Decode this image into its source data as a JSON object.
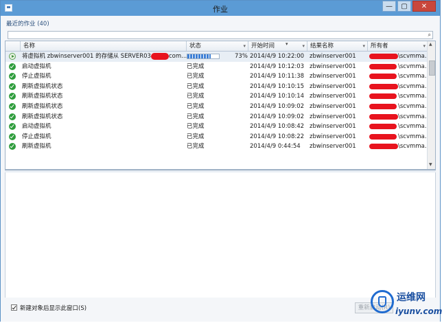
{
  "window": {
    "title": "作业",
    "controls": [
      "—",
      "▢",
      "✕"
    ]
  },
  "recent_label": "最近的作业 (40)",
  "search": {
    "placeholder": "",
    "value": ""
  },
  "icons": {
    "search": "search-icon",
    "succeeded": "checkmark-circle-icon",
    "running": "play-circle-icon",
    "app": "jobs-window-icon"
  },
  "columns": [
    {
      "label": "名称",
      "dropdown": false
    },
    {
      "label": "状态",
      "dropdown": true
    },
    {
      "label": "开始时间",
      "dropdown": true,
      "sorted": true
    },
    {
      "label": "结果名称",
      "dropdown": true
    },
    {
      "label": "所有者",
      "dropdown": true
    }
  ],
  "jobs": [
    {
      "name": "将虚拟机 zbwinserver001 的存储从 SERVER03",
      "name_tail": "com...",
      "status": "",
      "progress_percent": 73,
      "progress_label": "73%",
      "start_time": "2014/4/9 10:22:00",
      "result": "zbwinserver001",
      "owner_suffix": "\\scvmma...",
      "running": true
    },
    {
      "name": "启动虚拟机",
      "status": "已完成",
      "start_time": "2014/4/9 10:12:03",
      "result": "zbwinserver001",
      "owner_suffix": "\\scvmma...",
      "running": false
    },
    {
      "name": "停止虚拟机",
      "status": "已完成",
      "start_time": "2014/4/9 10:11:38",
      "result": "zbwinserver001",
      "owner_suffix": "\\scvmma...",
      "running": false
    },
    {
      "name": "刷新虚拟机状态",
      "status": "已完成",
      "start_time": "2014/4/9 10:10:15",
      "result": "zbwinserver001",
      "owner_suffix": "\\scvmma...",
      "running": false
    },
    {
      "name": "刷新虚拟机状态",
      "status": "已完成",
      "start_time": "2014/4/9 10:10:14",
      "result": "zbwinserver001",
      "owner_suffix": "\\scvmma...",
      "running": false
    },
    {
      "name": "刷新虚拟机状态",
      "status": "已完成",
      "start_time": "2014/4/9 10:09:02",
      "result": "zbwinserver001",
      "owner_suffix": "\\scvmma...",
      "running": false
    },
    {
      "name": "刷新虚拟机状态",
      "status": "已完成",
      "start_time": "2014/4/9 10:09:02",
      "result": "zbwinserver001",
      "owner_suffix": "\\scvmma...",
      "running": false
    },
    {
      "name": "启动虚拟机",
      "status": "已完成",
      "start_time": "2014/4/9 10:08:42",
      "result": "zbwinserver001",
      "owner_suffix": "\\scvmma...",
      "running": false
    },
    {
      "name": "停止虚拟机",
      "status": "已完成",
      "start_time": "2014/4/9 10:08:22",
      "result": "zbwinserver001",
      "owner_suffix": "\\scvmma...",
      "running": false
    },
    {
      "name": "刷新虚拟机",
      "status": "已完成",
      "start_time": "2014/4/9 0:44:54",
      "result": "zbwinserver001",
      "owner_suffix": "\\scvmma...",
      "running": false
    }
  ],
  "footer": {
    "show_window_checkbox_label": "新建对象后显示此窗口(S)",
    "show_window_checked": true,
    "restart_button_label": "重新启动(R)"
  },
  "watermark": {
    "title": "运维网",
    "url": "iyunv.com"
  },
  "colors": {
    "titlebar": "#5b9bd5",
    "redaction": "#e8131e",
    "success": "#2f9d3d",
    "progress": "#3d7fd6"
  }
}
